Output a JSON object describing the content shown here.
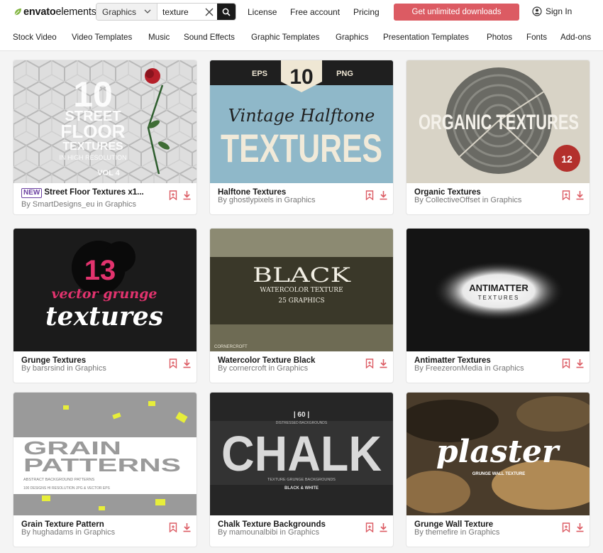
{
  "brand": {
    "name_a": "envato",
    "name_b": "elements"
  },
  "search": {
    "category": "Graphics",
    "query": "texture"
  },
  "topnav": {
    "license": "License",
    "free": "Free account",
    "pricing": "Pricing",
    "cta": "Get unlimited downloads",
    "signin": "Sign In"
  },
  "categories": [
    "Stock Video",
    "Video Templates",
    "Music",
    "Sound Effects",
    "Graphic Templates",
    "Graphics",
    "Presentation Templates",
    "Photos",
    "Fonts",
    "Add-ons"
  ],
  "colors": {
    "accent": "#dc5b63",
    "save": "#dc5b63",
    "badge": "#6b3fa0"
  },
  "icons": {
    "save": "bookmark-icon",
    "download": "download-icon",
    "search": "search-icon",
    "clear": "clear-icon",
    "chevron": "chevron-down-icon",
    "user": "user-icon"
  },
  "items": [
    {
      "badge": "NEW",
      "title": "Street Floor Textures x1...",
      "author": "By SmartDesigns_eu in Graphics",
      "art": {
        "big": "10",
        "l1": "STREET",
        "l2": "FLOOR",
        "l3": "TEXTURES",
        "l4": "IN HIGH RESOLUTION",
        "l5": "VOL 4"
      }
    },
    {
      "title": "Halftone Textures",
      "author": "By ghostlypixels in Graphics",
      "art": {
        "left": "EPS",
        "num": "10",
        "right": "PNG",
        "script": "Vintage Halftone",
        "big": "TEXTURES"
      }
    },
    {
      "title": "Organic Textures",
      "author": "By CollectiveOffset in Graphics",
      "art": {
        "big": "ORGANIC TEXTURES",
        "badge": "12"
      }
    },
    {
      "title": "Grunge Textures",
      "author": "By barsrsind in Graphics",
      "art": {
        "num": "13",
        "l1": "vector grunge",
        "l2": "textures"
      }
    },
    {
      "title": "Watercolor Texture Black",
      "author": "By cornercroft in Graphics",
      "art": {
        "big": "BLACK",
        "sub": "WATERCOLOR TEXTURE",
        "count": "25 GRAPHICS",
        "corner": "CORNERCROFT"
      }
    },
    {
      "title": "Antimatter Textures",
      "author": "By FreezeronMedia in Graphics",
      "art": {
        "l1": "ANTIMATTER",
        "l2": "TEXTURES"
      }
    },
    {
      "title": "Grain Texture Pattern",
      "author": "By hughadams in Graphics",
      "art": {
        "l1": "GRAIN",
        "l2": "PATTERNS",
        "sub": "ABSTRACT BACKGROUND PATTERNS",
        "small": "100 DESIGNS  HI RESOLUTION JPG & VECTOR EPS"
      }
    },
    {
      "title": "Chalk Texture Backgrounds",
      "author": "By mamounalbibi in Graphics",
      "art": {
        "count": "| 60 |",
        "top": "DISTRESSED BACKGROUNDS",
        "big": "CHALK",
        "sub": "TEXTURE GRUNGE BACKGROUNDS",
        "bw": "BLACK & WHITE"
      }
    },
    {
      "title": "Grunge Wall Texture",
      "author": "By themefire in Graphics",
      "art": {
        "big": "plaster",
        "sub": "GRUNGE WALL TEXTURE"
      }
    }
  ]
}
